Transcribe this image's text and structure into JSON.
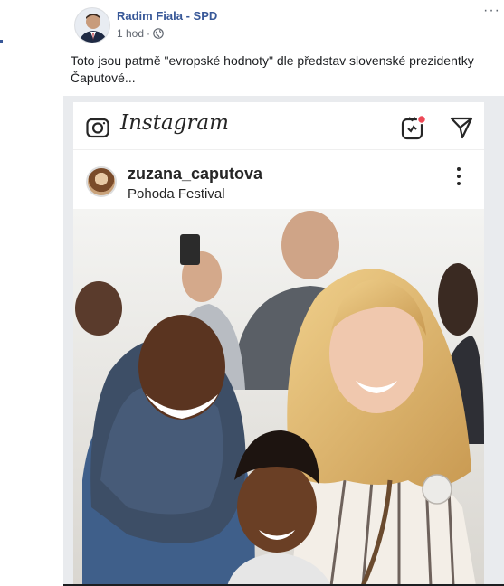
{
  "post": {
    "author": "Radim Fiala - SPD",
    "time": "1 hod",
    "meta_sep": "·",
    "more": "···",
    "text": "Toto jsou patrně \"evropské hodnoty\" dle představ slovenské prezidentky Čaputové..."
  },
  "instagram": {
    "logo": "Instagram",
    "username": "zuzana_caputova",
    "location": "Pohoda Festival",
    "icons": [
      "camera-icon",
      "igtv-icon",
      "direct-send-icon",
      "more-vertical-icon"
    ],
    "notification_color": "#ed4956"
  },
  "colors": {
    "author": "#385898",
    "meta": "#616770",
    "text": "#1c1e21"
  }
}
